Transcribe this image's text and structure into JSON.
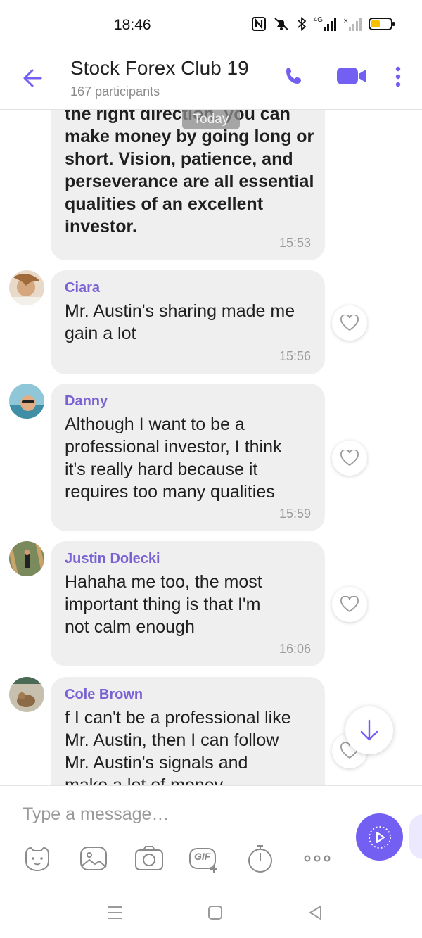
{
  "status_bar": {
    "time": "18:46",
    "icons": [
      "nfc-icon",
      "mute-icon",
      "bluetooth-icon",
      "signal-4g-icon",
      "signal-icon",
      "battery-icon"
    ],
    "network_label": "4G"
  },
  "header": {
    "title": "Stock Forex Club 19",
    "subtitle": "167 participants",
    "accent_color": "#7360f2"
  },
  "date_pill": "Today",
  "messages": [
    {
      "text": "the right direction, you can\nmake money by going long or\nshort. Vision, patience, and\nperseverance are all essential\nqualities of an excellent\ninvestor.",
      "time": "15:53"
    },
    {
      "name": "Ciara",
      "text": "Mr. Austin's sharing made me\ngain a lot",
      "time": "15:56"
    },
    {
      "name": "Danny",
      "text": "Although I want to be a\nprofessional investor, I think\nit's really hard because it\nrequires too many qualities",
      "time": "15:59"
    },
    {
      "name": "Justin Dolecki",
      "text": "Hahaha me too, the most\nimportant thing is that I'm\nnot calm enough",
      "time": "16:06"
    },
    {
      "name": "Cole Brown",
      "text": "f I can't be a professional like\nMr. Austin, then I can follow\nMr. Austin's signals and\nmake a lot of money"
    }
  ],
  "composer": {
    "placeholder": "Type a message…",
    "gif_label": "GIF",
    "tools": [
      "sticker-icon",
      "gallery-icon",
      "camera-icon",
      "gif-icon",
      "timer-icon",
      "more-icon"
    ]
  },
  "colors": {
    "accent": "#7360f2",
    "sender_name": "#7a62d4",
    "bubble": "#efefef"
  }
}
